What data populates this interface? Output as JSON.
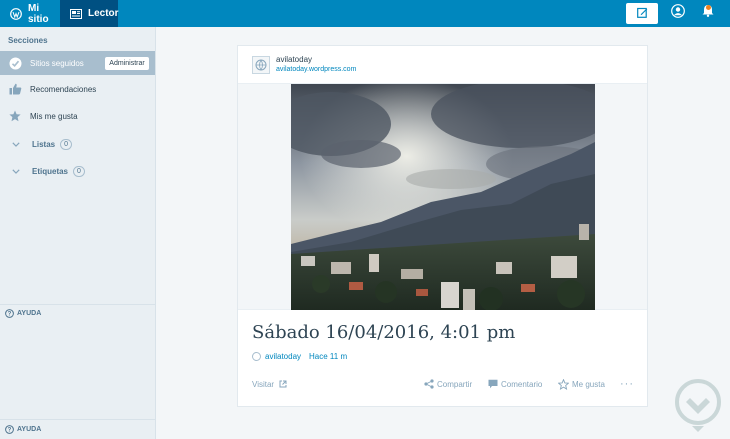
{
  "topbar": {
    "my_site_label": "Mi sitio",
    "reader_label": "Lector",
    "accent": "#0087be",
    "active_bg": "#005082"
  },
  "sidebar": {
    "section_heading": "Secciones",
    "followed_label": "Sitios seguidos",
    "manage_label": "Administrar",
    "recommendations_label": "Recomendaciones",
    "likes_label": "Mis me gusta",
    "lists_label": "Listas",
    "lists_count": "0",
    "tags_label": "Etiquetas",
    "tags_count": "0",
    "help_label": "AYUDA",
    "help_label_bottom": "AYUDA"
  },
  "post": {
    "site_name": "avilatoday",
    "site_url": "avilatoday.wordpress.com",
    "title": "Sábado 16/04/2016, 4:01 pm",
    "author": "avilatoday",
    "time_ago": "Hace 11 m",
    "visit_label": "Visitar",
    "share_label": "Compartir",
    "comment_label": "Comentario",
    "like_label": "Me gusta",
    "more_label": "···"
  },
  "icons": {
    "wordpress": "wordpress-icon",
    "reader": "reader-icon",
    "write": "write-icon",
    "me": "user-icon",
    "notifications": "bell-icon"
  }
}
